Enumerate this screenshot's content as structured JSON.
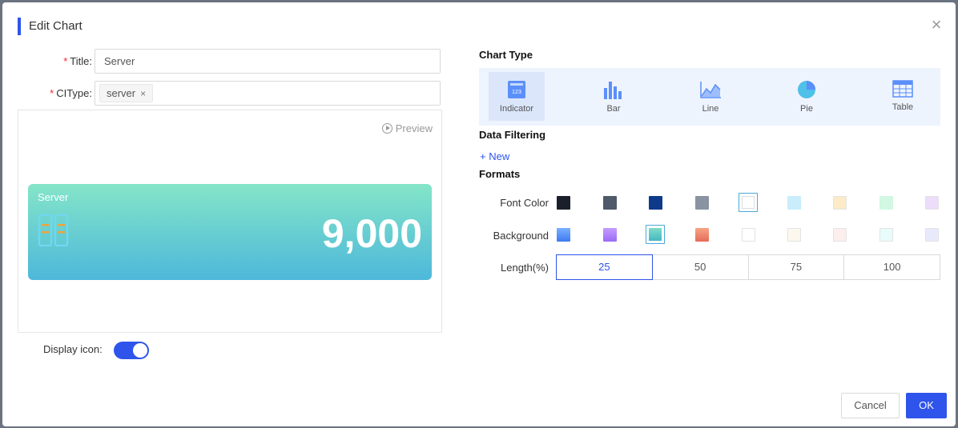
{
  "dialog": {
    "title": "Edit Chart"
  },
  "form": {
    "title_label": "Title",
    "title_value": "Server",
    "citype_label": "CIType",
    "citype_tag": "server",
    "colon": ":",
    "required_mark": "*"
  },
  "preview": {
    "link_label": "Preview",
    "card_title": "Server",
    "card_value": "9,000"
  },
  "display_icon": {
    "label": "Display icon",
    "enabled": true
  },
  "chart_type": {
    "heading": "Chart Type",
    "types": [
      {
        "label": "Indicator",
        "icon": "indicator-icon",
        "active": true
      },
      {
        "label": "Bar",
        "icon": "bar-chart-icon",
        "active": false
      },
      {
        "label": "Line",
        "icon": "line-chart-icon",
        "active": false
      },
      {
        "label": "Pie",
        "icon": "pie-chart-icon",
        "active": false
      },
      {
        "label": "Table",
        "icon": "table-icon",
        "active": false
      }
    ]
  },
  "data_filtering": {
    "heading": "Data Filtering",
    "new_label": "+ New"
  },
  "formats": {
    "heading": "Formats",
    "font_color_label": "Font Color",
    "font_colors": [
      "#1b1f2b",
      "#4f5a6b",
      "#0e3a8c",
      "#8a93a1",
      "#ffffff",
      "#c9edfb",
      "#fdebc8",
      "#d2f7e2",
      "#eddcfa"
    ],
    "font_color_selected": 4,
    "background_label": "Background",
    "backgrounds": [
      "linear-gradient(180deg,#78b0ff,#3f7af0)",
      "linear-gradient(180deg,#c49cff,#9b6cf5)",
      "linear-gradient(180deg,#7fdcc9,#46b7c2)",
      "linear-gradient(180deg,#f7a485,#e66b5a)",
      "#ffffff",
      "#fdf8ee",
      "#fdeeee",
      "#e8fcfb",
      "#e8eafc"
    ],
    "background_selected": 2,
    "length_label": "Length(%)",
    "lengths": [
      "25",
      "50",
      "75",
      "100"
    ],
    "length_selected": 0
  },
  "footer": {
    "cancel_label": "Cancel",
    "ok_label": "OK"
  }
}
